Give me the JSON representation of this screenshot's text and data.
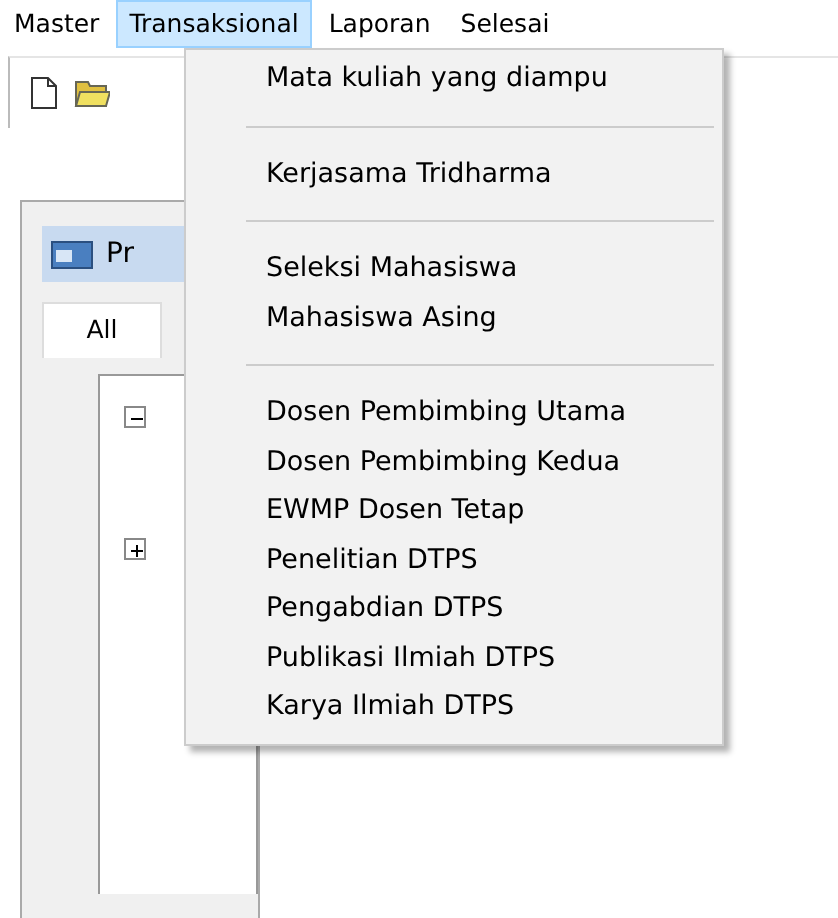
{
  "menu_bar": [
    {
      "label": "Master",
      "selected": false
    },
    {
      "label": "Transaksional",
      "selected": true
    },
    {
      "label": "Laporan",
      "selected": false
    },
    {
      "label": "Selesai",
      "selected": false
    }
  ],
  "panel": {
    "title": "Pr",
    "tabs": [
      {
        "label": "All",
        "selected": true
      }
    ],
    "tree": [
      {
        "expanded": true
      },
      {
        "expanded": false
      }
    ]
  },
  "dropdown": {
    "groups": [
      [
        "Mata kuliah yang diampu"
      ],
      [
        "Kerjasama Tridharma"
      ],
      [
        "Seleksi Mahasiswa",
        "Mahasiswa Asing"
      ],
      [
        "Dosen Pembimbing Utama",
        "Dosen Pembimbing Kedua",
        "EWMP Dosen Tetap",
        "Penelitian DTPS",
        "Pengabdian DTPS",
        "Publikasi Ilmiah DTPS",
        "Karya Ilmiah DTPS"
      ]
    ]
  }
}
